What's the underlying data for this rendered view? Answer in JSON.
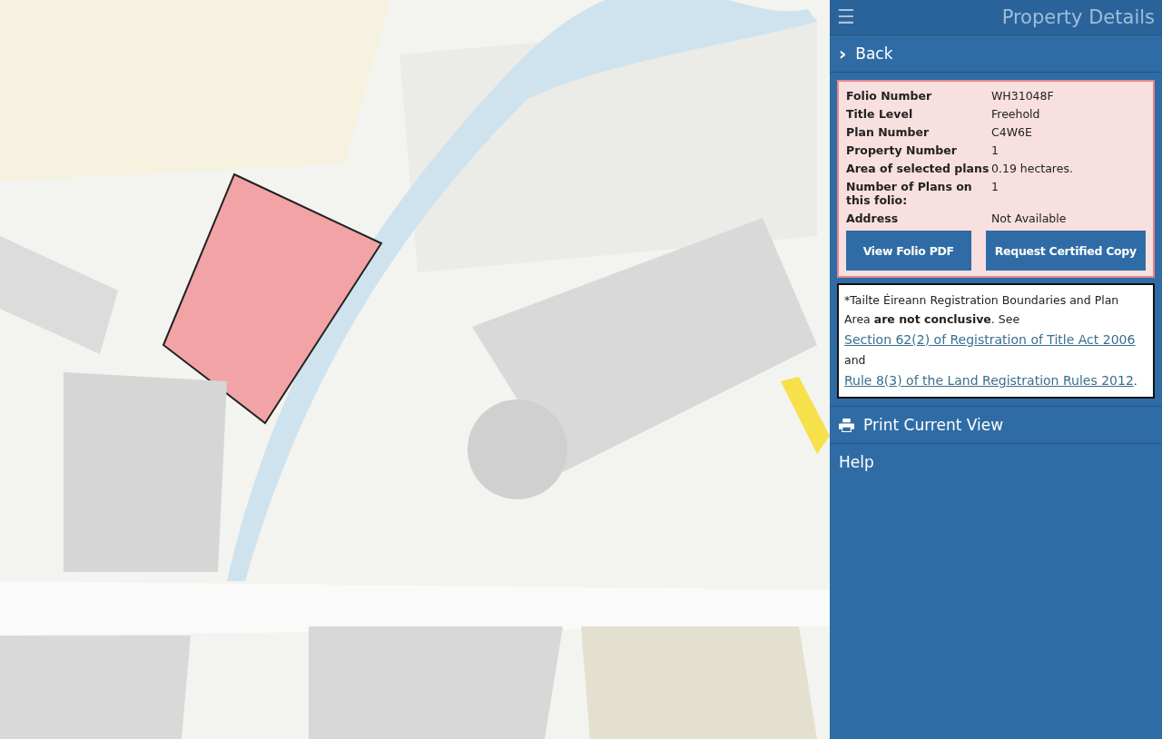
{
  "header": {
    "menu_icon": "☰",
    "title": "Property Details"
  },
  "back": {
    "icon": "›",
    "label": "Back"
  },
  "details": {
    "rows": [
      {
        "label": "Folio Number",
        "value": "WH31048F"
      },
      {
        "label": "Title Level",
        "value": "Freehold"
      },
      {
        "label": "Plan Number",
        "value": "C4W6E"
      },
      {
        "label": "Property Number",
        "value": "1"
      },
      {
        "label": "Area of selected plans",
        "value": "0.19 hectares."
      },
      {
        "label": "Number of Plans on this folio:",
        "value": "1"
      },
      {
        "label": "Address",
        "value": "Not Available"
      }
    ],
    "buttons": [
      "View Folio PDF",
      "Request Certified Copy"
    ]
  },
  "disclaimer": {
    "segments": [
      {
        "kind": "text",
        "text": "*Tailte Éireann Registration Boundaries and Plan Area **are not conclusive**. See "
      },
      {
        "kind": "link",
        "text": "Section 62(2) of Registration of Title Act 2006"
      },
      {
        "kind": "text",
        "text": " and "
      },
      {
        "kind": "link",
        "text": "Rule 8(3) of the Land Registration Rules 2012"
      },
      {
        "kind": "text",
        "text": "."
      }
    ]
  },
  "menu": [
    {
      "kind": "print",
      "label": "Print Current View"
    },
    {
      "kind": "plain",
      "label": "Help"
    }
  ]
}
